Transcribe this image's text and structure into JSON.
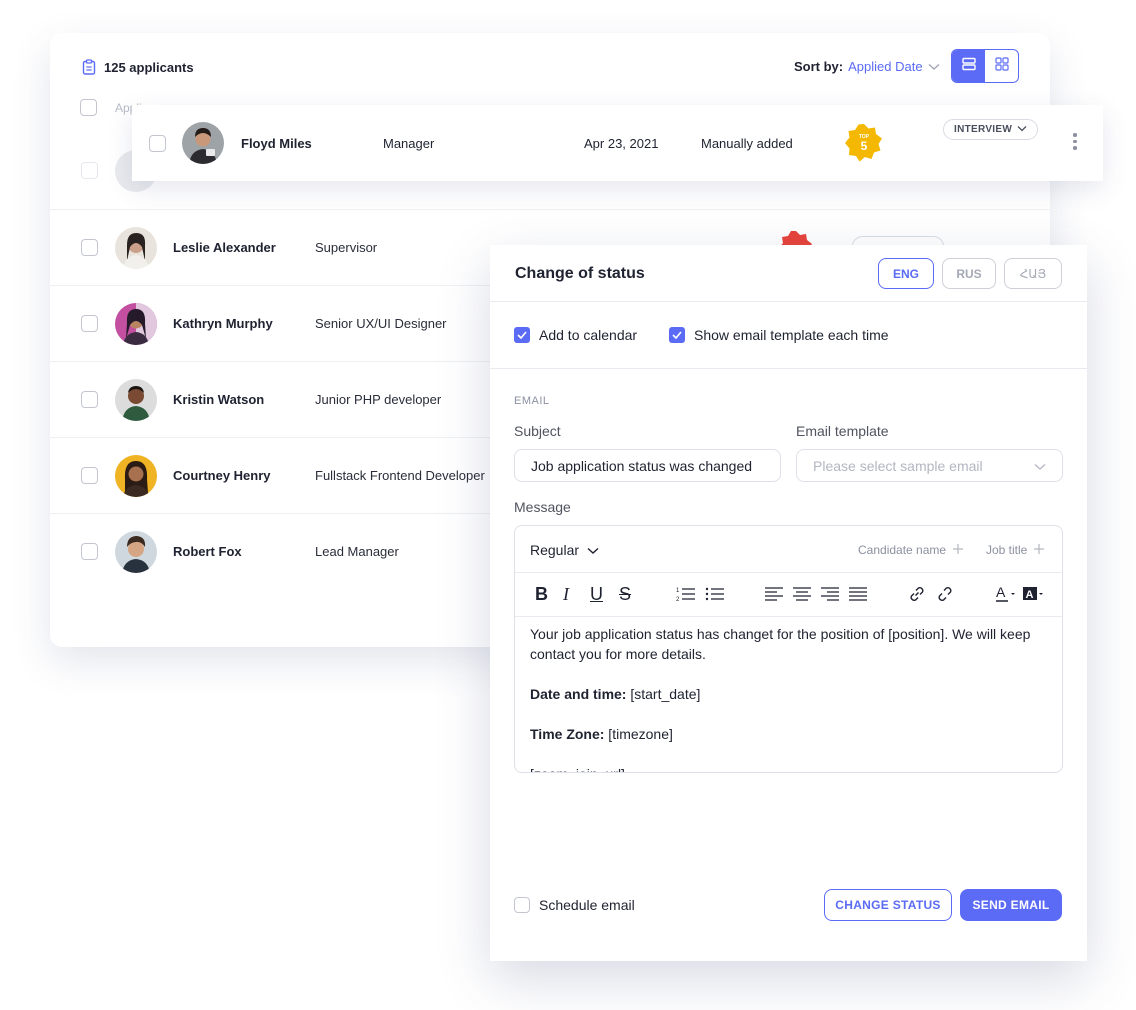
{
  "applicants": {
    "count_label": "125 applicants",
    "sort_label": "Sort by:",
    "sort_value": "Applied Date",
    "header_partial": "Appli",
    "rows": [
      {
        "name": "Leslie Alexander",
        "role": "Supervisor"
      },
      {
        "name": "Kathryn Murphy",
        "role": "Senior UX/UI Designer"
      },
      {
        "name": "Kristin Watson",
        "role": "Junior PHP developer"
      },
      {
        "name": "Courtney Henry",
        "role": "Fullstack Frontend Developer"
      },
      {
        "name": "Robert Fox",
        "role": "Lead Manager"
      }
    ]
  },
  "highlighted_row": {
    "name": "Floyd Miles",
    "role": "Manager",
    "date": "Apr 23, 2021",
    "source": "Manually added",
    "badge_top": "TOP",
    "badge_rank": "5",
    "status": "INTERVIEW"
  },
  "modal": {
    "title": "Change of status",
    "languages": [
      "ENG",
      "RUS",
      "ՀԱՅ"
    ],
    "add_to_calendar": "Add to calendar",
    "show_template": "Show email template each time",
    "section_email": "EMAIL",
    "subject_label": "Subject",
    "subject_value": "Job application status was changed",
    "template_label": "Email template",
    "template_placeholder": "Please select sample email",
    "message_label": "Message",
    "editor": {
      "style": "Regular",
      "candidate_name": "Candidate name",
      "job_title": "Job title",
      "p1": "Your job application status has changet for the position of [position]. We will keep contact you for more details.",
      "date_label": "Date and time:",
      "date_value": " [start_date]",
      "tz_label": "Time Zone:",
      "tz_value": " [timezone]",
      "zoom": "[zoom_join_url]"
    },
    "schedule_email": "Schedule email",
    "change_status": "CHANGE STATUS",
    "send_email": "SEND EMAIL"
  },
  "colors": {
    "accent": "#5b6bf5",
    "badge_gold": "#f5b800",
    "badge_red": "#e8443a"
  }
}
